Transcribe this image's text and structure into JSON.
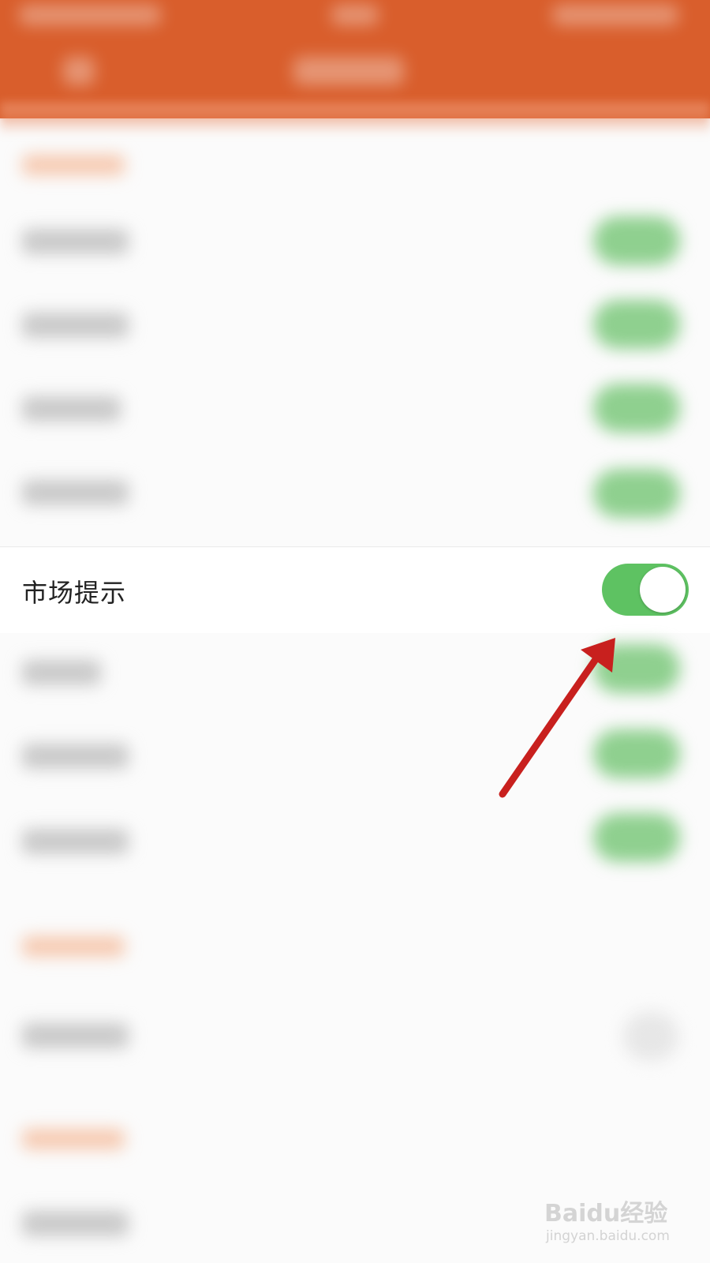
{
  "focused_setting": {
    "label": "市场提示",
    "enabled": true
  },
  "colors": {
    "header": "#d95e2c",
    "toggle_on": "#5ec262",
    "annotation_arrow": "#c8201e"
  },
  "watermark": {
    "brand": "Baidu经验",
    "url": "jingyan.baidu.com"
  }
}
